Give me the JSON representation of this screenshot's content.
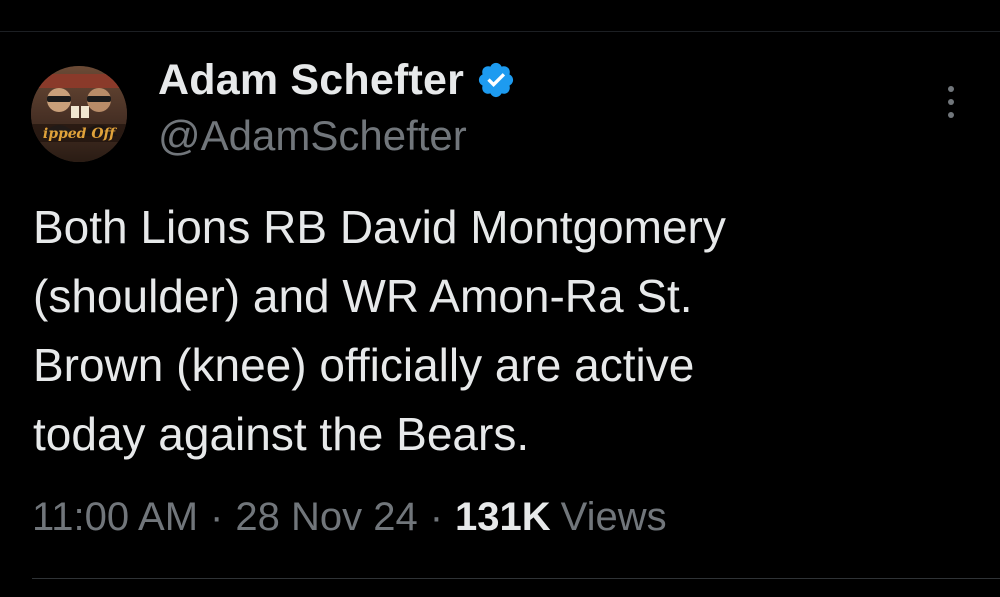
{
  "tweet": {
    "author": {
      "display_name": "Adam Schefter",
      "handle": "@AdamSchefter",
      "verified": true,
      "verified_icon": "verified-badge-icon",
      "avatar_icon": "avatar-photo"
    },
    "text": "Both Lions RB David Montgomery\n(shoulder) and WR Amon-Ra St.\nBrown (knee) officially are active\ntoday against the Bears.",
    "time": "11:00 AM",
    "separator": "·",
    "date": "28 Nov 24",
    "views_count": "131K",
    "views_label": "Views",
    "more_icon": "more-vertical-icon"
  },
  "colors": {
    "background": "#000000",
    "primary_text": "#e7e9ea",
    "secondary_text": "#71767b",
    "verified_blue": "#1d9bf0",
    "divider": "#2f3336"
  }
}
